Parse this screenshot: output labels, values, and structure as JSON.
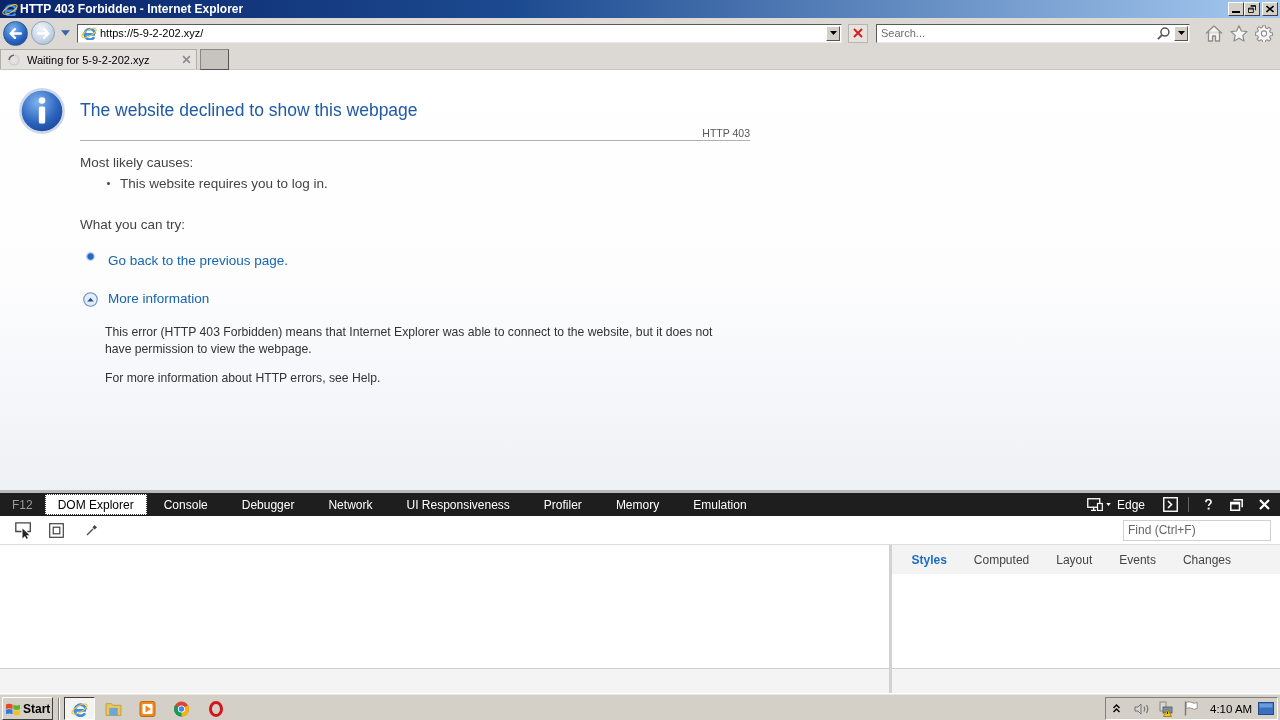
{
  "window": {
    "title": "HTTP 403 Forbidden - Internet Explorer"
  },
  "address_bar": {
    "url": "https://5-9-2-202.xyz/"
  },
  "search": {
    "placeholder": "Search..."
  },
  "tabs": [
    {
      "label": "Waiting for 5-9-2-202.xyz",
      "selected": true,
      "loading": true
    }
  ],
  "page": {
    "heading": "The website declined to show this webpage",
    "code": "HTTP 403",
    "causes_label": "Most likely causes:",
    "causes": [
      "This website requires you to log in."
    ],
    "try_label": "What you can try:",
    "actions": [
      {
        "kind": "link",
        "label": "Go back to the previous page."
      },
      {
        "kind": "expander",
        "label": "More information",
        "expanded": true,
        "details": [
          "This error (HTTP 403 Forbidden) means that Internet Explorer was able to connect to the website, but it does not have permission to view the webpage.",
          "For more information about HTTP errors, see Help."
        ]
      }
    ]
  },
  "devtools": {
    "label": "F12",
    "tabs": [
      {
        "label": "DOM Explorer",
        "selected": true
      },
      {
        "label": "Console",
        "selected": false
      },
      {
        "label": "Debugger",
        "selected": false
      },
      {
        "label": "Network",
        "selected": false
      },
      {
        "label": "UI Responsiveness",
        "selected": false
      },
      {
        "label": "Profiler",
        "selected": false
      },
      {
        "label": "Memory",
        "selected": false
      },
      {
        "label": "Emulation",
        "selected": false
      }
    ],
    "mode": "Edge",
    "find": {
      "placeholder": "Find (Ctrl+F)"
    },
    "side_tabs": [
      {
        "label": "Styles",
        "selected": true
      },
      {
        "label": "Computed",
        "selected": false
      },
      {
        "label": "Layout",
        "selected": false
      },
      {
        "label": "Events",
        "selected": false
      },
      {
        "label": "Changes",
        "selected": false
      }
    ]
  },
  "taskbar": {
    "start": "Start",
    "items": [
      {
        "selected": true
      },
      {
        "selected": false
      },
      {
        "selected": false
      },
      {
        "selected": false
      },
      {
        "selected": false
      }
    ],
    "clock": "4:10 AM"
  }
}
